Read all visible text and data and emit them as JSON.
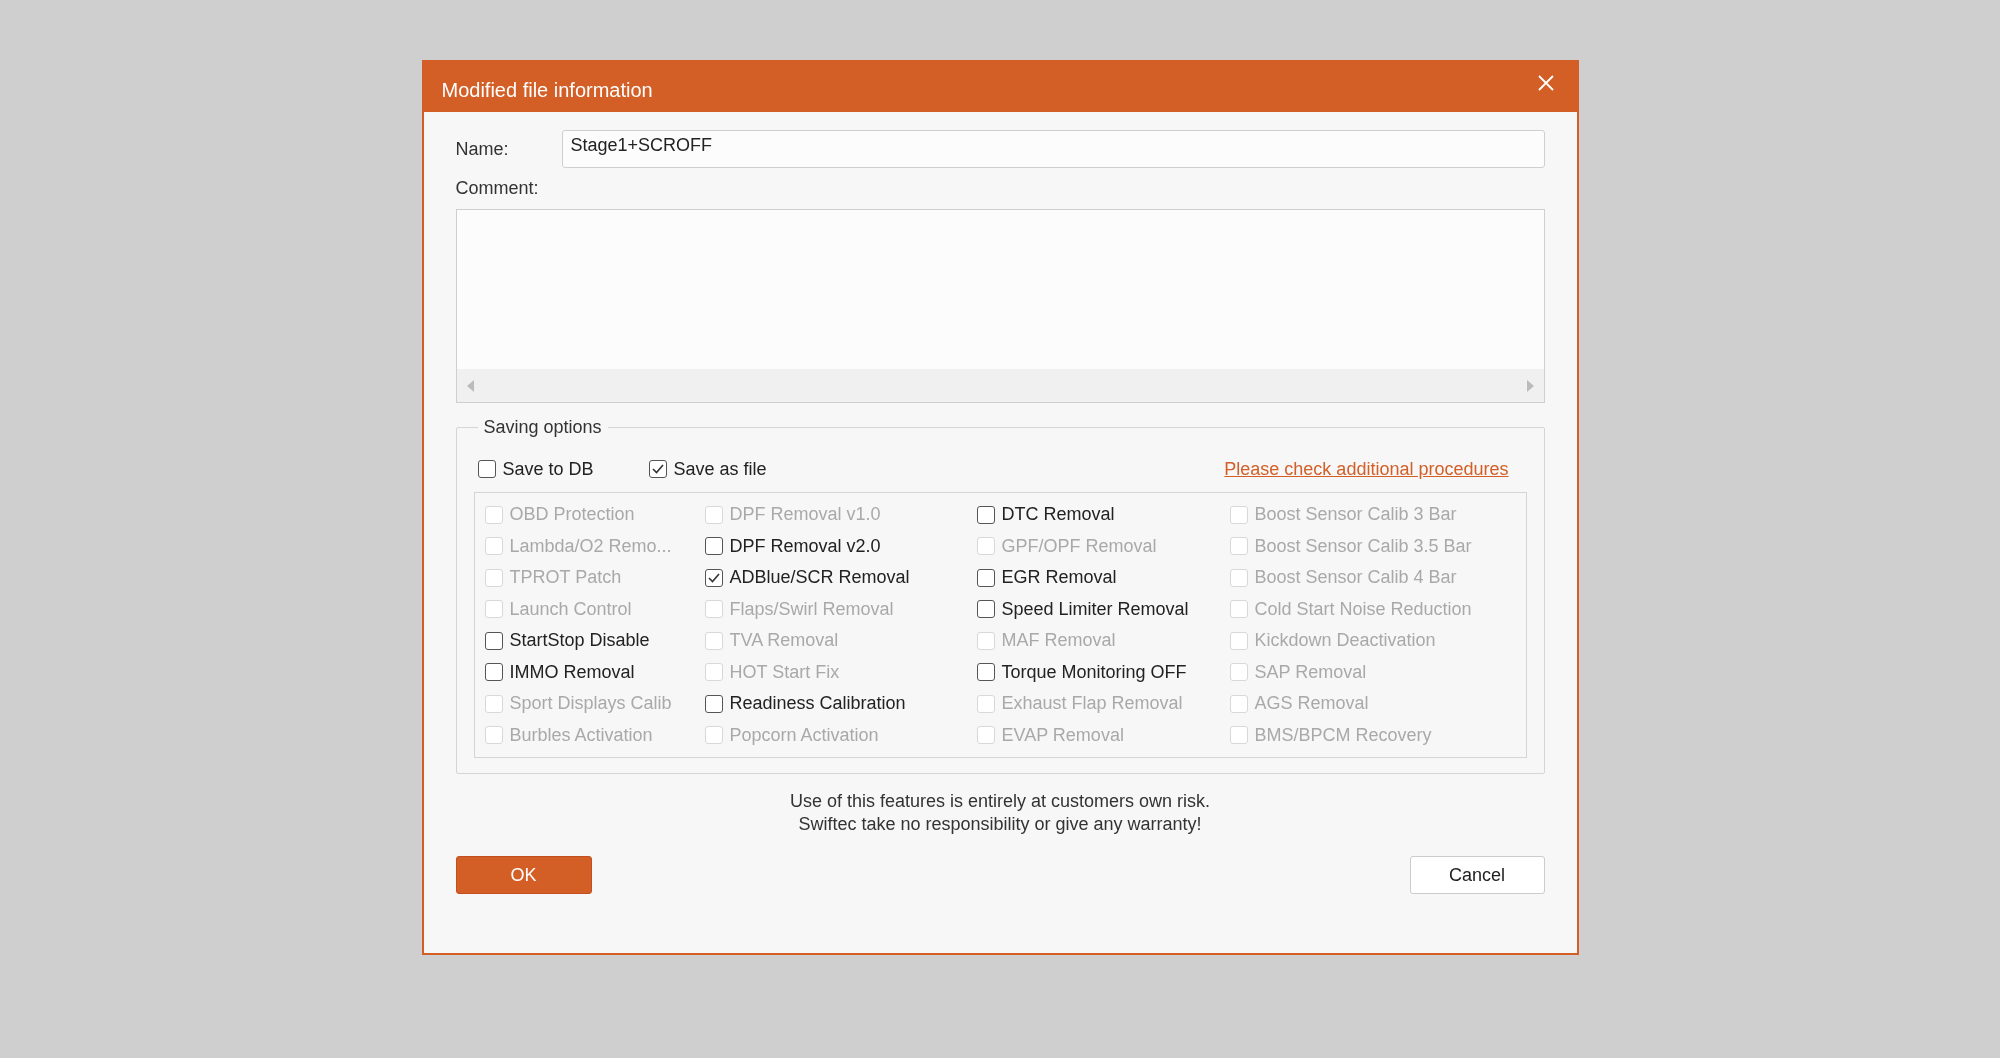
{
  "window": {
    "title": "Modified file information"
  },
  "name_field": {
    "label": "Name:",
    "value": "Stage1+SCROFF"
  },
  "comment_field": {
    "label": "Comment:"
  },
  "saving_options": {
    "title": "Saving options",
    "targets": [
      {
        "label": "Save to DB",
        "checked": false
      },
      {
        "label": "Save as file",
        "checked": true
      }
    ],
    "link": "Please check additional procedures",
    "options": [
      {
        "label": "OBD Protection",
        "checked": false,
        "disabled": true
      },
      {
        "label": "Lambda/O2 Remo...",
        "checked": false,
        "disabled": true
      },
      {
        "label": "TPROT Patch",
        "checked": false,
        "disabled": true
      },
      {
        "label": "Launch Control",
        "checked": false,
        "disabled": true
      },
      {
        "label": "StartStop Disable",
        "checked": false,
        "disabled": false
      },
      {
        "label": "IMMO Removal",
        "checked": false,
        "disabled": false
      },
      {
        "label": "Sport Displays Calib",
        "checked": false,
        "disabled": true
      },
      {
        "label": "Burbles Activation",
        "checked": false,
        "disabled": true
      },
      {
        "label": "DPF Removal v1.0",
        "checked": false,
        "disabled": true
      },
      {
        "label": "DPF Removal v2.0",
        "checked": false,
        "disabled": false
      },
      {
        "label": "ADBlue/SCR Removal",
        "checked": true,
        "disabled": false
      },
      {
        "label": "Flaps/Swirl Removal",
        "checked": false,
        "disabled": true
      },
      {
        "label": "TVA Removal",
        "checked": false,
        "disabled": true
      },
      {
        "label": "HOT Start Fix",
        "checked": false,
        "disabled": true
      },
      {
        "label": "Readiness Calibration",
        "checked": false,
        "disabled": false
      },
      {
        "label": "Popcorn Activation",
        "checked": false,
        "disabled": true
      },
      {
        "label": "DTC Removal",
        "checked": false,
        "disabled": false
      },
      {
        "label": "GPF/OPF Removal",
        "checked": false,
        "disabled": true
      },
      {
        "label": "EGR Removal",
        "checked": false,
        "disabled": false
      },
      {
        "label": "Speed Limiter Removal",
        "checked": false,
        "disabled": false
      },
      {
        "label": "MAF Removal",
        "checked": false,
        "disabled": true
      },
      {
        "label": "Torque Monitoring OFF",
        "checked": false,
        "disabled": false
      },
      {
        "label": "Exhaust Flap Removal",
        "checked": false,
        "disabled": true
      },
      {
        "label": "EVAP Removal",
        "checked": false,
        "disabled": true
      },
      {
        "label": "Boost Sensor Calib 3 Bar",
        "checked": false,
        "disabled": true
      },
      {
        "label": "Boost Sensor Calib 3.5 Bar",
        "checked": false,
        "disabled": true
      },
      {
        "label": "Boost Sensor Calib 4 Bar",
        "checked": false,
        "disabled": true
      },
      {
        "label": "Cold Start Noise Reduction",
        "checked": false,
        "disabled": true
      },
      {
        "label": "Kickdown Deactivation",
        "checked": false,
        "disabled": true
      },
      {
        "label": "SAP Removal",
        "checked": false,
        "disabled": true
      },
      {
        "label": "AGS Removal",
        "checked": false,
        "disabled": true
      },
      {
        "label": "BMS/BPCM Recovery",
        "checked": false,
        "disabled": true
      }
    ]
  },
  "disclaimer": [
    "Use of this features is entirely at customers own risk.",
    "Swiftec take no responsibility or give any warranty!"
  ],
  "buttons": [
    "OK",
    "Cancel"
  ]
}
